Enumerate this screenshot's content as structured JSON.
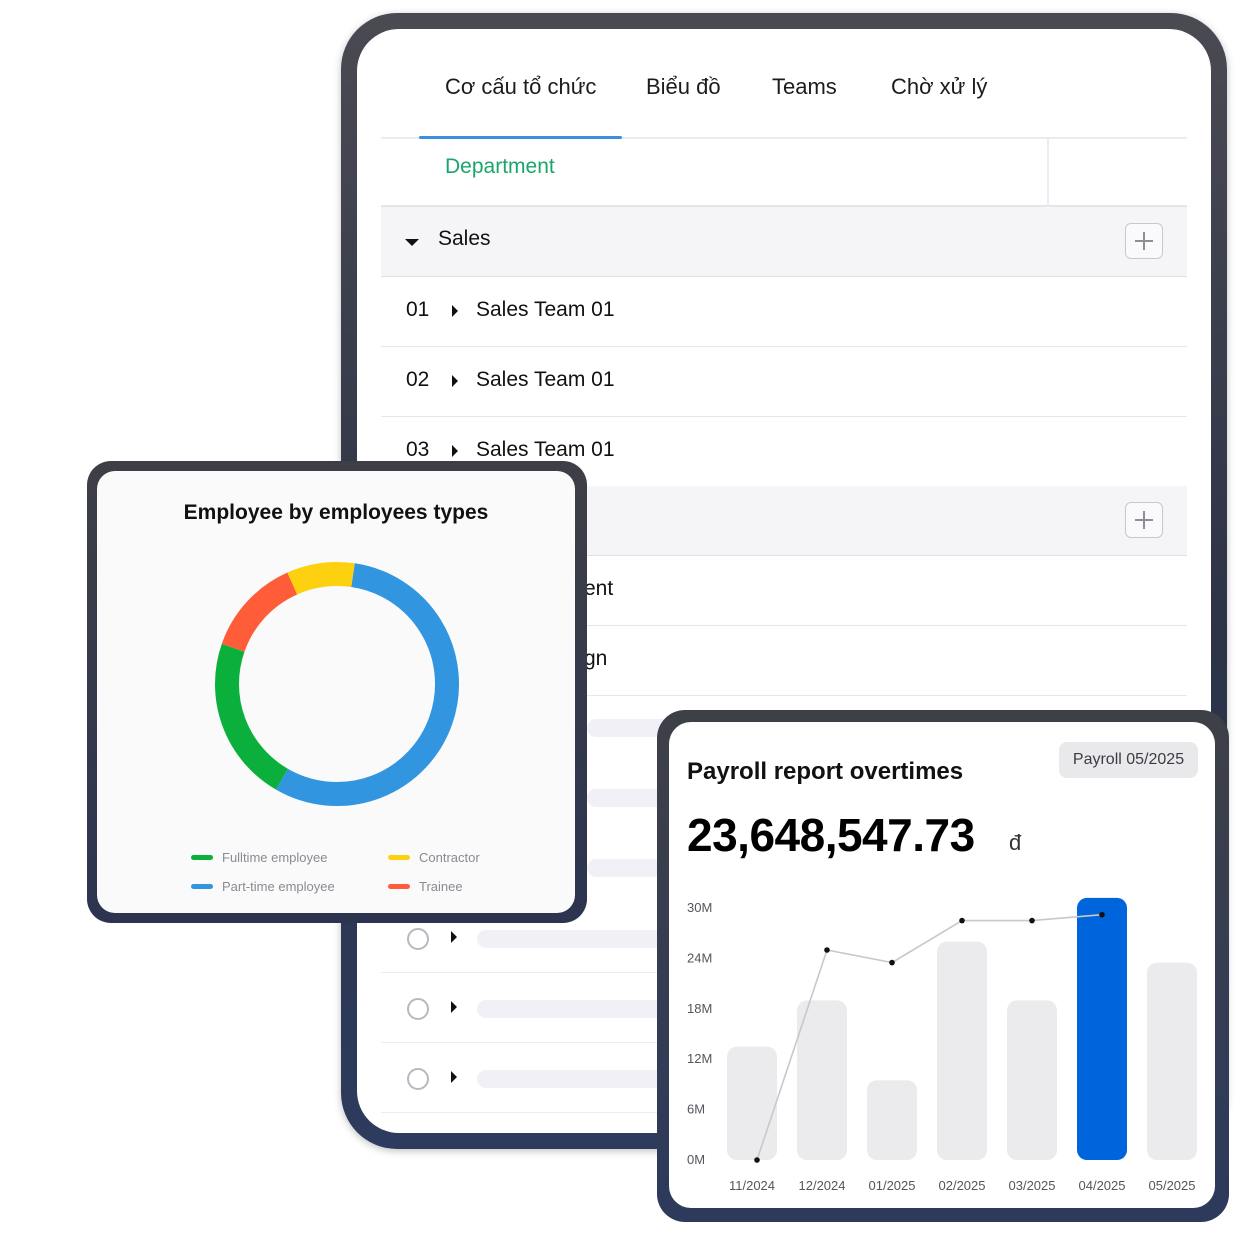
{
  "tabs": [
    {
      "label": "Cơ cấu tổ chức",
      "active": true
    },
    {
      "label": "Biểu đồ"
    },
    {
      "label": "Teams"
    },
    {
      "label": "Chờ xử lý"
    }
  ],
  "table": {
    "header_label": "Department",
    "groups": [
      {
        "label": "Sales",
        "teams": [
          {
            "no": "01",
            "label": "Sales Team 01"
          },
          {
            "no": "02",
            "label": "Sales Team 01"
          },
          {
            "no": "03",
            "label": "Sales Team 01"
          }
        ]
      }
    ],
    "partial_items": [
      "ent",
      "gn"
    ]
  },
  "donut_card": {
    "title": "Employee by employees types",
    "legend": [
      {
        "label": "Fulltime employee",
        "color": "#0bb03c"
      },
      {
        "label": "Contractor",
        "color": "#fdd10f"
      },
      {
        "label": "Part-time employee",
        "color": "#3195e0"
      },
      {
        "label": "Trainee",
        "color": "#ff5c39"
      }
    ]
  },
  "payroll_card": {
    "title": "Payroll report overtimes",
    "badge": "Payroll 05/2025",
    "amount": "23,648,547.73",
    "currency": "đ"
  },
  "chart_data": [
    {
      "type": "pie",
      "title": "Employee by employees types",
      "categories": [
        "Fulltime employee",
        "Trainee",
        "Contractor",
        "Part-time employee"
      ],
      "values": [
        22,
        13,
        9,
        56
      ],
      "colors": [
        "#0bb03c",
        "#ff5c39",
        "#fdd10f",
        "#3195e0"
      ]
    },
    {
      "type": "bar",
      "title": "Payroll report overtimes",
      "categories": [
        "11/2024",
        "12/2024",
        "01/2025",
        "02/2025",
        "03/2025",
        "04/2025",
        "05/2025"
      ],
      "values": [
        13.5,
        19,
        9.5,
        26,
        19,
        31.2,
        23.5
      ],
      "line_values": [
        0,
        25,
        23.5,
        28.5,
        28.5,
        29.2,
        null
      ],
      "highlight_index": 5,
      "yticks": [
        "0M",
        "6M",
        "12M",
        "18M",
        "24M",
        "30M"
      ],
      "ylim": [
        0,
        30
      ],
      "bar_color": "#ebebee",
      "highlight_color": "#0065dd"
    }
  ]
}
